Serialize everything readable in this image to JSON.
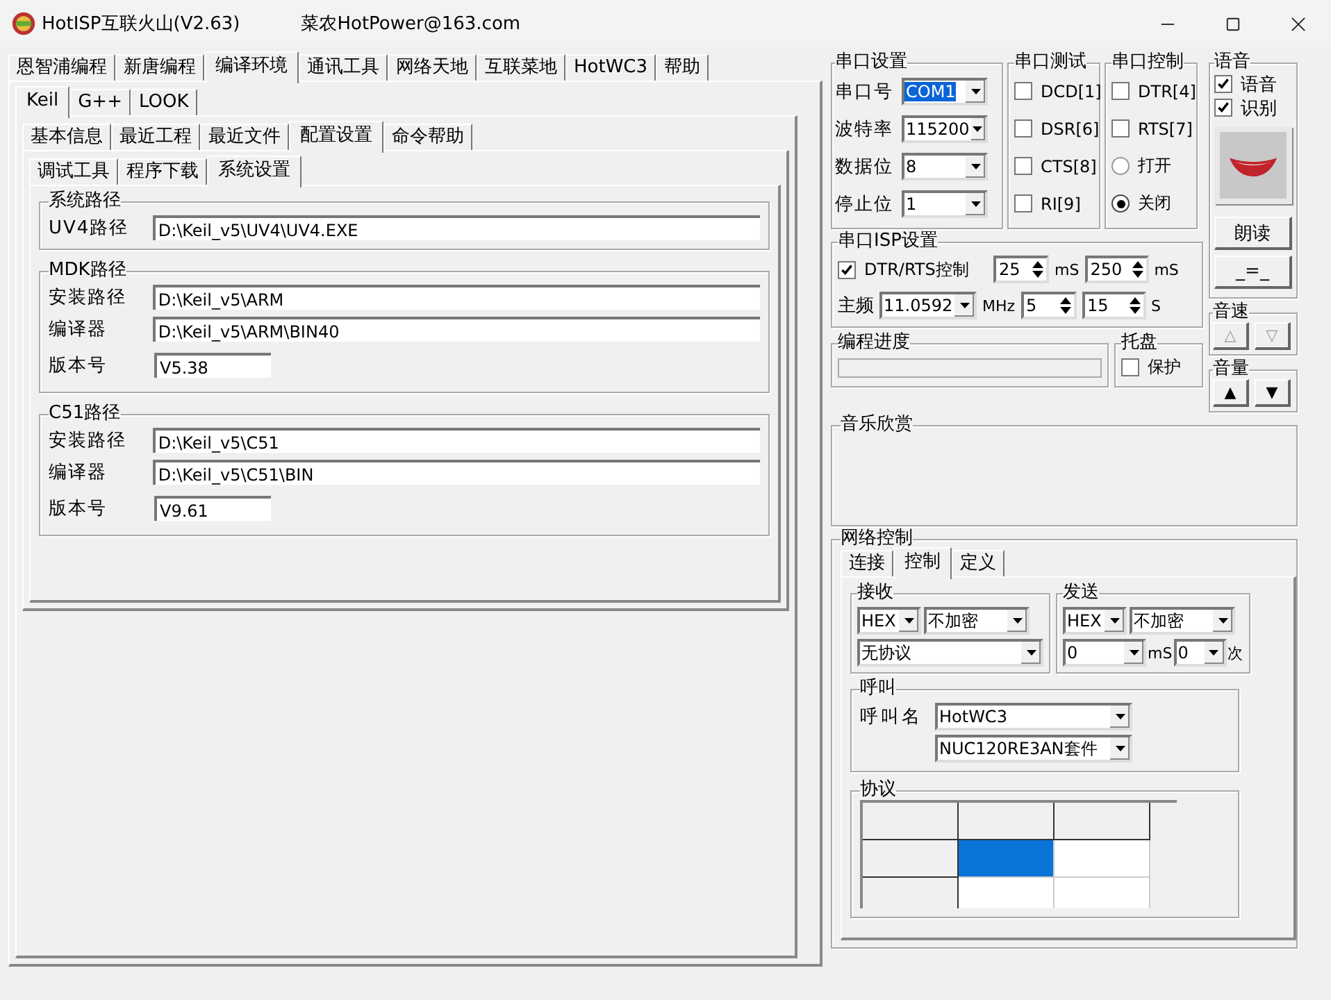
{
  "window": {
    "title": "HotISP互联火山(V2.63)",
    "subtitle": "菜农HotPower@163.com"
  },
  "main_tabs": [
    {
      "label": "恩智浦编程",
      "selected": false
    },
    {
      "label": "新唐编程",
      "selected": false
    },
    {
      "label": "编译环境",
      "selected": true
    },
    {
      "label": "通讯工具",
      "selected": false
    },
    {
      "label": "网络天地",
      "selected": false
    },
    {
      "label": "互联菜地",
      "selected": false
    },
    {
      "label": "HotWC3",
      "selected": false
    },
    {
      "label": "帮助",
      "selected": false
    }
  ],
  "compiler_tabs": [
    {
      "label": "Keil",
      "selected": true
    },
    {
      "label": "G++",
      "selected": false
    },
    {
      "label": "LOOK",
      "selected": false
    }
  ],
  "keil_tabs": [
    {
      "label": "基本信息",
      "selected": false
    },
    {
      "label": "最近工程",
      "selected": false
    },
    {
      "label": "最近文件",
      "selected": false
    },
    {
      "label": "配置设置",
      "selected": true
    },
    {
      "label": "命令帮助",
      "selected": false
    }
  ],
  "config_tabs": [
    {
      "label": "调试工具",
      "selected": false
    },
    {
      "label": "程序下载",
      "selected": false
    },
    {
      "label": "系统设置",
      "selected": true
    }
  ],
  "path_groups": [
    {
      "title": "系统路径",
      "fields": [
        {
          "kind": "path",
          "label": "UV4路径",
          "value": "D:\\Keil_v5\\UV4\\UV4.EXE"
        }
      ]
    },
    {
      "title": "MDK路径",
      "fields": [
        {
          "kind": "path",
          "label": "安装路径",
          "value": "D:\\Keil_v5\\ARM"
        },
        {
          "kind": "path",
          "label": "编译器",
          "value": "D:\\Keil_v5\\ARM\\BIN40"
        },
        {
          "kind": "version",
          "label": "版本号",
          "value": "V5.38"
        }
      ]
    },
    {
      "title": "C51路径",
      "fields": [
        {
          "kind": "path",
          "label": "安装路径",
          "value": "D:\\Keil_v5\\C51"
        },
        {
          "kind": "path",
          "label": "编译器",
          "value": "D:\\Keil_v5\\C51\\BIN"
        },
        {
          "kind": "version",
          "label": "版本号",
          "value": "V9.61"
        }
      ]
    }
  ],
  "serial_settings": {
    "title": "串口设置",
    "fields": [
      {
        "label": "串口号",
        "value": "COM1",
        "selected": true
      },
      {
        "label": "波特率",
        "value": "115200",
        "selected": false
      },
      {
        "label": "数据位",
        "value": "8",
        "selected": false
      },
      {
        "label": "停止位",
        "value": "1",
        "selected": false
      }
    ]
  },
  "serial_test": {
    "title": "串口测试",
    "items": [
      {
        "label": "DCD[1]",
        "checked": false
      },
      {
        "label": "DSR[6]",
        "checked": false
      },
      {
        "label": "CTS[8]",
        "checked": false
      },
      {
        "label": "RI[9]",
        "checked": false
      }
    ]
  },
  "serial_control": {
    "title": "串口控制",
    "items": [
      {
        "kind": "checkbox",
        "label": "DTR[4]",
        "checked": false
      },
      {
        "kind": "checkbox",
        "label": "RTS[7]",
        "checked": false
      },
      {
        "kind": "radio",
        "label": "打开",
        "selected": false
      },
      {
        "kind": "radio",
        "label": "关闭",
        "selected": true
      }
    ]
  },
  "voice": {
    "title": "语音",
    "options": [
      {
        "label": "语音",
        "checked": true
      },
      {
        "label": "识别",
        "checked": true
      }
    ],
    "buttons": [
      "朗读",
      "_=_"
    ]
  },
  "isp": {
    "title": "串口ISP设置",
    "control": {
      "label": "DTR/RTS控制",
      "checked": true
    },
    "delay1": "25",
    "delay1_unit": "mS",
    "delay2": "250",
    "delay2_unit": "mS",
    "freq_label": "主频",
    "freq": "11.0592",
    "freq_unit": "MHz",
    "count1": "5",
    "count2": "15",
    "count2_unit": "S"
  },
  "progress": {
    "title": "编程进度",
    "level": 0
  },
  "tray": {
    "title": "托盘",
    "option": {
      "label": "保护",
      "checked": false
    }
  },
  "speed": {
    "title": "音速",
    "buttons": [
      "△",
      "▽"
    ]
  },
  "volume": {
    "title": "音量",
    "buttons": [
      "▲",
      "▼"
    ]
  },
  "music": {
    "title": "音乐欣赏"
  },
  "network": {
    "title": "网络控制",
    "tabs": [
      {
        "label": "连接",
        "selected": false
      },
      {
        "label": "控制",
        "selected": true
      },
      {
        "label": "定义",
        "selected": false
      }
    ],
    "receive": {
      "title": "接收",
      "format": "HEX",
      "encryption": "不加密",
      "protocol": "无协议"
    },
    "send": {
      "title": "发送",
      "format": "HEX",
      "encryption": "不加密",
      "interval": "0",
      "interval_unit": "mS",
      "count": "0",
      "count_unit": "次"
    },
    "call": {
      "title": "呼叫",
      "label": "呼叫名",
      "name": "HotWC3",
      "device": "NUC120RE3AN套件"
    },
    "protocol": {
      "title": "协议",
      "rows": [
        {
          "cells": [
            {
              "selected": false
            },
            {
              "selected": false
            },
            {
              "selected": false
            }
          ]
        },
        {
          "cells": [
            {
              "selected": false
            },
            {
              "selected": true
            },
            {
              "selected": false
            }
          ]
        },
        {
          "cells": [
            {
              "selected": false
            },
            {
              "selected": false
            },
            {
              "selected": false
            }
          ]
        }
      ]
    }
  }
}
